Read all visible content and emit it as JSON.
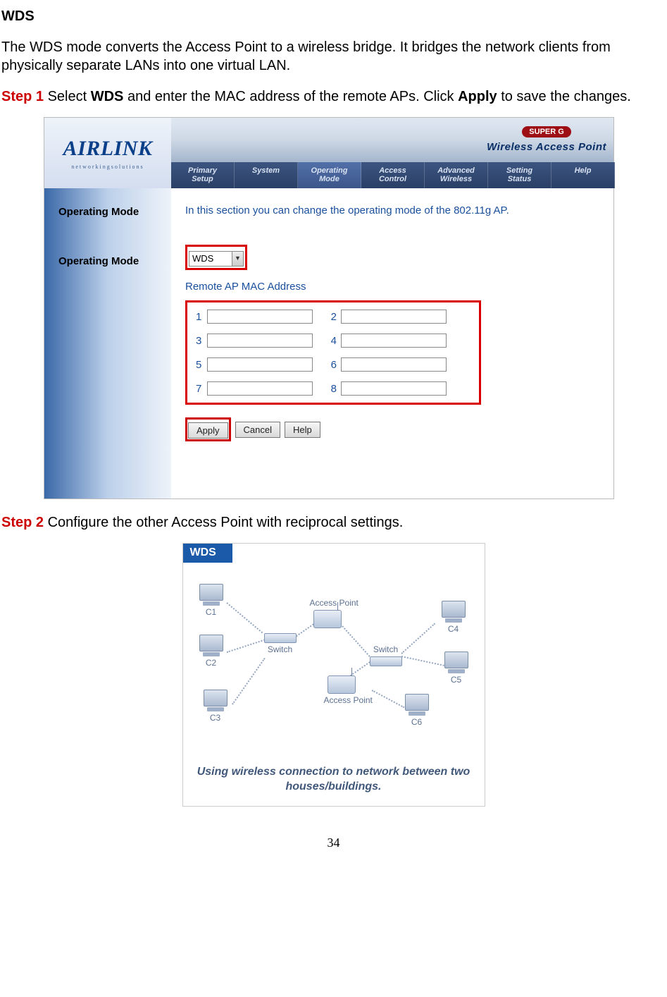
{
  "title": "WDS",
  "intro": "The WDS mode converts the Access Point to a wireless bridge. It bridges the network clients from physically separate LANs into one virtual LAN.",
  "step1_prefix": "Step 1",
  "step1_text_a": " Select ",
  "step1_bold_a": "WDS",
  "step1_text_b": " and enter the MAC address of the remote APs.  Click ",
  "step1_bold_b": "Apply",
  "step1_text_c": " to save the changes.",
  "step2_prefix": "Step 2",
  "step2_text": " Configure the other Access Point with reciprocal settings.",
  "page_number": "34",
  "screenshot1": {
    "logo_main": "AIRLINK",
    "logo_sub": "networkingsolutions",
    "brand_super": "SUPER G",
    "brand_wap": "Wireless Access Point",
    "tabs": [
      "Primary\nSetup",
      "System",
      "Operating\nMode",
      "Access\nControl",
      "Advanced\nWireless",
      "Setting\nStatus",
      "Help"
    ],
    "side_label_1": "Operating Mode",
    "side_label_2": "Operating Mode",
    "desc": "In this section you can change the operating mode of the 802.11g AP.",
    "select_value": "WDS",
    "remote_label": "Remote AP MAC Address",
    "mac_numbers": [
      "1",
      "2",
      "3",
      "4",
      "5",
      "6",
      "7",
      "8"
    ],
    "mac_values": [
      "",
      "",
      "",
      "",
      "",
      "",
      "",
      ""
    ],
    "btn_apply": "Apply",
    "btn_cancel": "Cancel",
    "btn_help": "Help"
  },
  "screenshot2": {
    "title": "WDS",
    "nodes": {
      "c1": "C1",
      "c2": "C2",
      "c3": "C3",
      "c4": "C4",
      "c5": "C5",
      "c6": "C6",
      "ap1": "Access Point",
      "ap2": "Access Point",
      "sw1": "Switch",
      "sw2": "Switch"
    },
    "caption": "Using wireless connection to network between two houses/buildings."
  }
}
